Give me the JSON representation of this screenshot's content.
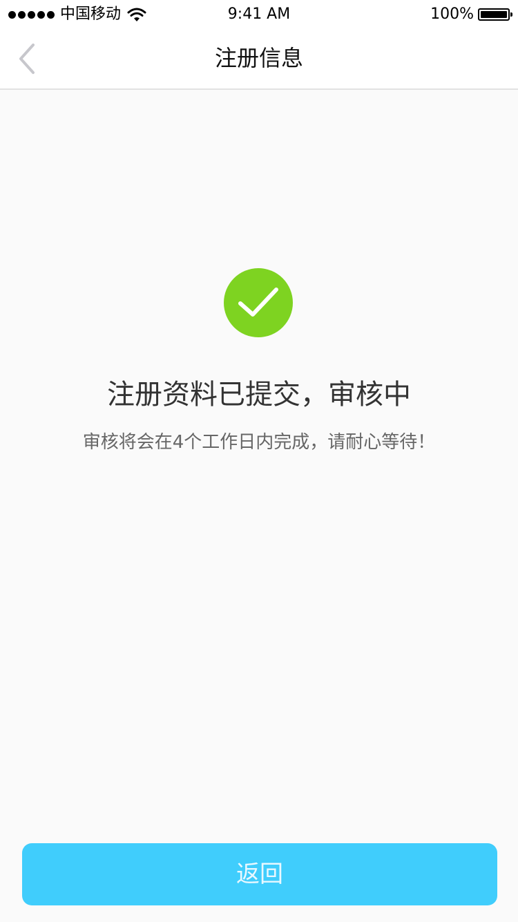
{
  "status_bar": {
    "carrier": "中国移动",
    "time": "9:41 AM",
    "battery": "100%",
    "icons": [
      "signal-dots-icon",
      "wifi-icon",
      "battery-icon"
    ]
  },
  "nav": {
    "title": "注册信息",
    "back_icon": "chevron-left-icon"
  },
  "main": {
    "status_icon": "checkmark-circle-icon",
    "title": "注册资料已提交，审核中",
    "subtitle": "审核将会在4个工作日内完成，请耐心等待！",
    "return_button": "返回"
  },
  "colors": {
    "success_green": "#7ed321",
    "button_blue": "#40cdfc",
    "background": "#fafafa"
  }
}
